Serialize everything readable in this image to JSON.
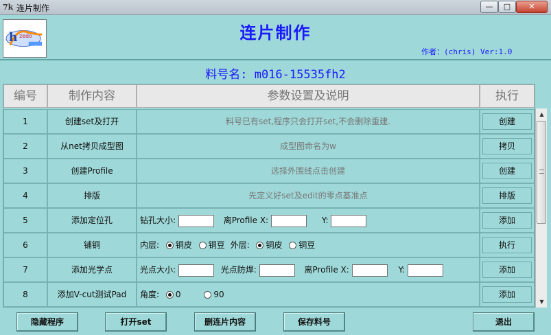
{
  "window": {
    "icon_text": "7k",
    "title": "连片制作",
    "min_symbol": "—",
    "max_symbol": "□",
    "close_symbol": "✕"
  },
  "header": {
    "app_title": "连片制作",
    "author": "作者：(chris)  Ver:1.0",
    "part_number": "料号名: m016-15535fh2"
  },
  "table": {
    "headers": [
      "编号",
      "制作内容",
      "参数设置及说明",
      "执行"
    ],
    "rows": [
      {
        "no": "1",
        "name": "创建set及打开",
        "note": "料号已有set,程序只会打开set,不会删除重建.",
        "action": "创建"
      },
      {
        "no": "2",
        "name": "从net拷贝成型图",
        "note": "成型图命名为w",
        "action": "拷贝"
      },
      {
        "no": "3",
        "name": "创建Profile",
        "note": "选择外围线点击创建",
        "action": "创建"
      },
      {
        "no": "4",
        "name": "排版",
        "note": "先定义好set及edit的零点基准点",
        "action": "排版"
      },
      {
        "no": "5",
        "name": "添加定位孔",
        "drill_label": "钻孔大小:",
        "profile_x_label": "离Profile X:",
        "y_label": "Y:",
        "drill_value": "",
        "x_value": "",
        "y_value": "",
        "action": "添加"
      },
      {
        "no": "6",
        "name": "铺铜",
        "inner_label": "内层:",
        "outer_label": "外层:",
        "opt_copper": "铜皮",
        "opt_dot": "铜豆",
        "inner_selected": "铜皮",
        "outer_selected": "铜皮",
        "action": "执行"
      },
      {
        "no": "7",
        "name": "添加光学点",
        "fid_size_label": "光点大小:",
        "fid_weld_label": "光点防焊:",
        "profile_x_label": "离Profile X:",
        "y_label": "Y:",
        "action": "添加"
      },
      {
        "no": "8",
        "name": "添加V-cut测试Pad",
        "angle_label": "角度:",
        "opt_0": "0",
        "opt_90": "90",
        "angle_selected": "0",
        "action": "添加"
      }
    ]
  },
  "buttons": {
    "hide": "隐藏程序",
    "open_set": "打开set",
    "delete": "删连片内容",
    "save": "保存料号",
    "exit": "退出"
  },
  "scrollbar": {
    "up": "▲",
    "down": "▼"
  }
}
